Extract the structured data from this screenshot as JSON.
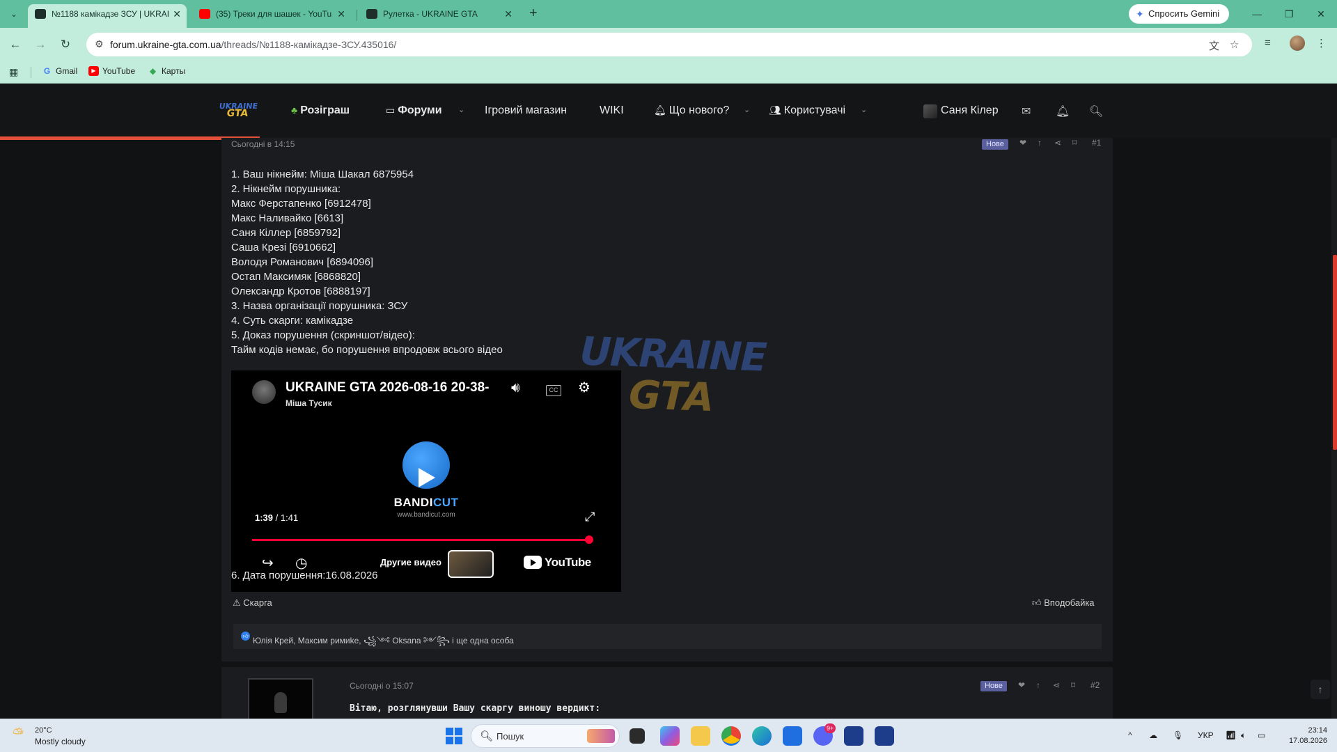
{
  "browser": {
    "tabs": [
      {
        "title": "№1188 камікадзе ЗСУ | UKRAI",
        "active": true
      },
      {
        "title": "(35) Треки для шашек - YouTu",
        "active": false
      },
      {
        "title": "Рулетка - UKRAINE GTA",
        "active": false
      }
    ],
    "gemini_label": "Спросить Gemini",
    "url_host": "forum.ukraine-gta.com.ua",
    "url_path": "/threads/№1188-камікадзе-ЗСУ.435016/",
    "bookmarks": [
      "Gmail",
      "YouTube",
      "Карты"
    ],
    "accent": "#5fbf9e"
  },
  "forum": {
    "logo": {
      "line1": "UKRAINE",
      "line2": "GTA"
    },
    "nav": {
      "giveaway": "Розіграш",
      "forums": "Форуми",
      "shop": "Ігровий магазин",
      "wiki": "WIKI",
      "whats_new": "Що нового?",
      "users": "Користувачі",
      "username": "Саня Кілер"
    },
    "post1": {
      "date": "Сьогодні в 14:15",
      "badge": "Нове",
      "number": "#1",
      "lines": [
        "1. Ваш нікнейм: Міша Шакал 6875954",
        "2. Нікнейм порушника:",
        "Макс Ферстапенко [6912478]",
        "Макс Наливайко [6613]",
        "Саня Кіллер [6859792]",
        "Саша Крезі [6910662]",
        "Володя Романович [6894096]",
        "Остап Максимяк [6868820]",
        "Олександр Кротов [6888197]",
        "3. Назва організації порушника: ЗСУ",
        "4. Суть скарги: камікадзе",
        "5. Доказ порушення (скриншот/відео):",
        "Тайм кодів немає, бо порушення впродовж всього відео"
      ],
      "video": {
        "title": "UKRAINE GTA 2026-08-16 20-38-",
        "channel": "Міша Тусик",
        "brand": "BANDI",
        "brand_accent": "CUT",
        "brand_url": "www.bandicut.com",
        "time_current": "1:39",
        "time_total": "1:41",
        "progress": 0.98,
        "more_videos": "Другие видео",
        "youtube": "YouTube"
      },
      "date_line": "6. Дата порушення:16.08.2026",
      "report": "Скарга",
      "like": "Вподобайка",
      "reactions": "Юлія Крей, Максим римиkе, ꧁༺ Oksana ༻꧂ і ще одна особа"
    },
    "watermark": {
      "line1": "UKRAINE",
      "line2": "GTA"
    },
    "post2": {
      "date": "Сьогодні о 15:07",
      "badge": "Нове",
      "number": "#2",
      "text": "Вітаю, розглянувши Вашу скаргу виношу вердикт:"
    }
  },
  "taskbar": {
    "temp": "20°C",
    "weather": "Mostly cloudy",
    "search_placeholder": "Пошук",
    "lang": "УКР",
    "time": "23:14",
    "date": "17.08.2026",
    "notif": "9+"
  }
}
